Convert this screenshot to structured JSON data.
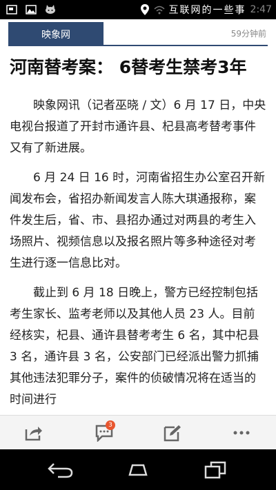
{
  "status_bar": {
    "icons": [
      "image-icon",
      "gallery-icon",
      "cat-icon",
      "location-icon"
    ],
    "ticker": "互联网的一些事",
    "clock": "2:47"
  },
  "header": {
    "source": "映象网",
    "time_ago": "59分钟前"
  },
  "article": {
    "title": "河南替考案： 6替考生禁考3年",
    "paragraphs": [
      "映象网讯（记者巫晓 / 文）6 月 17 日，中央电视台报道了开封市通许县、杞县高考替考事件又有了新进展。",
      "6 月 24 日 16 时，河南省招生办公室召开新闻发布会，省招办新闻发言人陈大琪通报称，案件发生后，省、市、县招办通过对两县的考生入场照片、视频信息以及报名照片等多种途径对考生进行逐一信息比对。",
      "截止到 6 月 18 日晚上，警方已经控制包括考生家长、监考老师以及其他人员 23 人。目前经核实，杞县、通许县替考考生 6 名，其中杞县 3 名，通许县 3 名，公安部门已经派出警力抓捕其他违法犯罪分子，案件的侦破情况将在适当的时间进行"
    ]
  },
  "toolbar": {
    "comment_count": "3",
    "items": [
      "share-icon",
      "comment-icon",
      "edit-icon",
      "more-icon"
    ]
  },
  "navbar": {
    "items": [
      "back-icon",
      "home-icon",
      "recents-icon"
    ]
  },
  "colors": {
    "accent": "#2f4a72",
    "badge": "#e8562f"
  }
}
